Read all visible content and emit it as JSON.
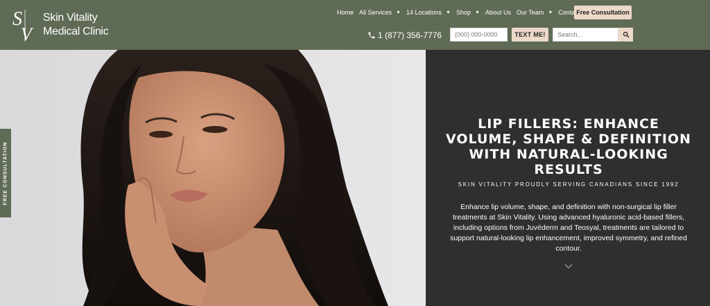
{
  "header": {
    "logo": {
      "monogram": "SV",
      "line1": "Skin Vitality",
      "line2": "Medical Clinic"
    },
    "nav": [
      {
        "label": "Home",
        "dropdown": false
      },
      {
        "label": "All Services",
        "dropdown": true
      },
      {
        "label": "14 Locations",
        "dropdown": true
      },
      {
        "label": "Shop",
        "dropdown": true
      },
      {
        "label": "About Us",
        "dropdown": false
      },
      {
        "label": "Our Team",
        "dropdown": true
      },
      {
        "label": "Contact Us",
        "dropdown": false
      }
    ],
    "consult_button": "Free Consultation",
    "phone": "1 (877) 356-7776",
    "text_input_placeholder": "(000) 000-0000",
    "text_button": "TEXT ME!",
    "search_placeholder": "Search..."
  },
  "side_tab": {
    "label": "FREE CONSULTATION"
  },
  "hero": {
    "title": "LIP FILLERS: ENHANCE VOLUME, SHAPE & DEFINITION WITH NATURAL-LOOKING RESULTS",
    "subtitle": "SKIN VITALITY PROUDLY SERVING CANADIANS SINCE 1992",
    "body": "Enhance lip volume, shape, and definition with non-surgical lip filler treatments at Skin Vitality. Using advanced hyaluronic acid-based fillers, including options from Juvéderm and Teosyal, treatments are tailored to support natural-looking lip enhancement, improved symmetry, and refined contour."
  },
  "colors": {
    "header_bg": "#5f6b55",
    "accent_button": "#ecd9c8",
    "hero_panel_bg": "#2f2f2f",
    "text_light": "#ffffff"
  },
  "icons": {
    "phone": "phone-icon",
    "search": "search-icon",
    "caret": "chevron-down-icon",
    "scroll": "chevron-down-icon"
  }
}
